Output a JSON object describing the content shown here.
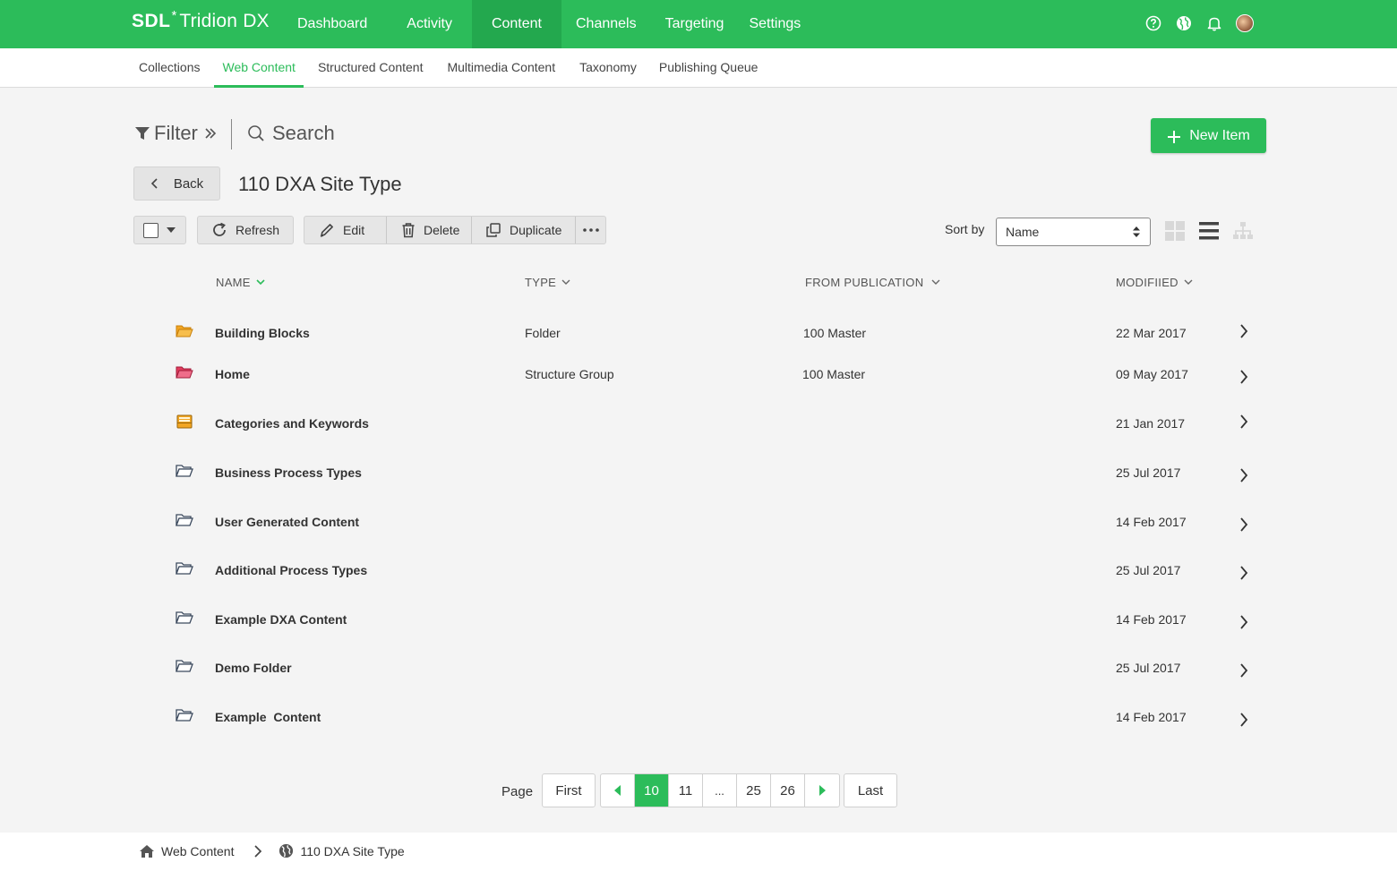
{
  "app": {
    "logo_brand": "SDL",
    "logo_star": "*",
    "logo_product": "Tridion DX"
  },
  "topnav": [
    {
      "label": "Dashboard",
      "active": false
    },
    {
      "label": "Activity",
      "active": false
    },
    {
      "label": "Content",
      "active": true
    },
    {
      "label": "Channels",
      "active": false
    },
    {
      "label": "Targeting",
      "active": false
    },
    {
      "label": "Settings",
      "active": false
    }
  ],
  "topicons": [
    "help-icon",
    "globe-icon",
    "bell-icon",
    "user-avatar"
  ],
  "subnav": [
    {
      "label": "Collections",
      "active": false
    },
    {
      "label": "Web Content",
      "active": true
    },
    {
      "label": "Structured Content",
      "active": false
    },
    {
      "label": "Multimedia Content",
      "active": false
    },
    {
      "label": "Taxonomy",
      "active": false
    },
    {
      "label": "Publishing Queue",
      "active": false
    }
  ],
  "filter_label": "Filter",
  "search_label": "Search",
  "new_item_label": "New Item",
  "back_label": "Back",
  "page_title": "110 DXA Site Type",
  "toolbar": {
    "refresh": "Refresh",
    "edit": "Edit",
    "delete": "Delete",
    "duplicate": "Duplicate"
  },
  "sort": {
    "label": "Sort by",
    "value": "Name"
  },
  "columns": {
    "name": "NAME",
    "type": "TYPE",
    "from_publication": "FROM PUBLICATION",
    "modified": "MODIFIIED"
  },
  "rows": [
    {
      "name": "Building Blocks",
      "type": "Folder",
      "publication": "100 Master",
      "modified": "22 Mar 2017",
      "icon": "folder-open-orange-icon"
    },
    {
      "name": "Home",
      "type": "Structure Group",
      "publication": "100 Master",
      "modified": "09 May 2017",
      "icon": "folder-open-red-icon"
    },
    {
      "name": "Categories and Keywords",
      "type": "",
      "publication": "",
      "modified": "21 Jan 2017",
      "icon": "categories-box-icon"
    },
    {
      "name": "Business Process Types",
      "type": "",
      "publication": "",
      "modified": "25 Jul 2017",
      "icon": "folder-open-icon"
    },
    {
      "name": "User Generated Content",
      "type": "",
      "publication": "",
      "modified": "14 Feb 2017",
      "icon": "folder-open-icon"
    },
    {
      "name": "Additional Process Types",
      "type": "",
      "publication": "",
      "modified": "25 Jul 2017",
      "icon": "folder-open-icon"
    },
    {
      "name": "Example DXA Content",
      "type": "",
      "publication": "",
      "modified": "14 Feb 2017",
      "icon": "folder-open-icon"
    },
    {
      "name": "Demo Folder",
      "type": "",
      "publication": "",
      "modified": "25 Jul 2017",
      "icon": "folder-open-icon"
    },
    {
      "name": "Example  Content",
      "type": "",
      "publication": "",
      "modified": "14 Feb 2017",
      "icon": "folder-open-icon"
    }
  ],
  "pagination": {
    "label": "Page",
    "first": "First",
    "last": "Last",
    "pages": [
      "10",
      "11",
      "...",
      "25",
      "26"
    ],
    "current": "10"
  },
  "breadcrumb": [
    {
      "label": "Web Content",
      "icon": "home-icon"
    },
    {
      "label": "110 DXA Site Type",
      "icon": "globe-icon"
    }
  ],
  "colors": {
    "accent": "#2cbc5a",
    "accent_dark": "#23a84e",
    "folder_orange": "#f2a623",
    "folder_red": "#e23c5e",
    "folder_dark": "#3c4a5e"
  }
}
